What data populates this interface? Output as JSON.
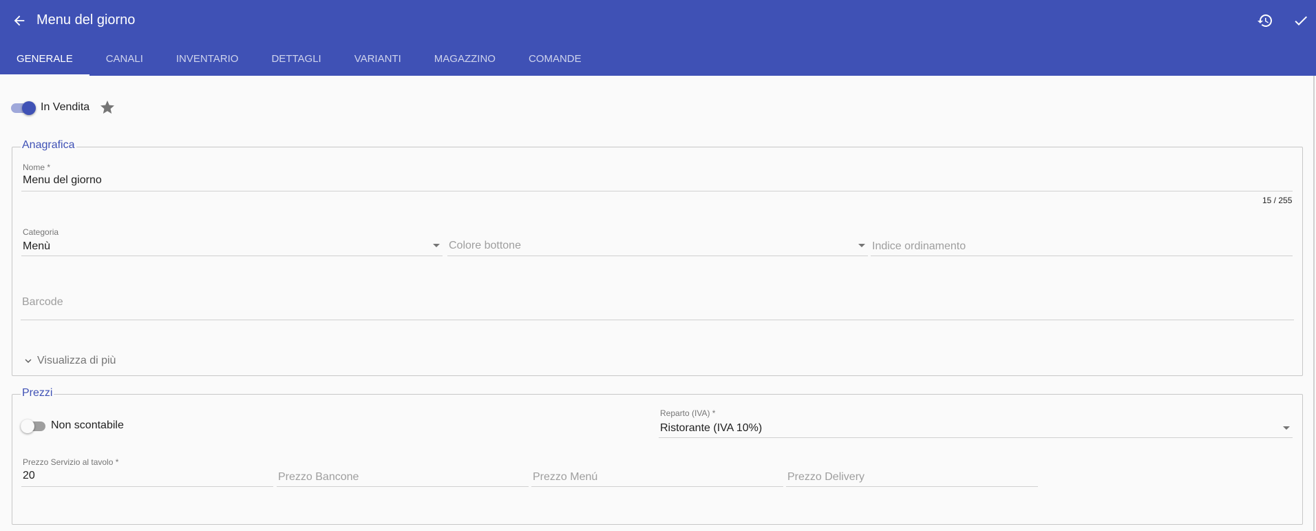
{
  "header": {
    "title": "Menu del giorno",
    "back_icon": "arrow-left-icon",
    "history_icon": "history-icon",
    "confirm_icon": "check-icon",
    "accent": "#3f51b5"
  },
  "tabs": [
    {
      "label": "GENERALE",
      "active": true
    },
    {
      "label": "CANALI"
    },
    {
      "label": "INVENTARIO"
    },
    {
      "label": "DETTAGLI"
    },
    {
      "label": "VARIANTI"
    },
    {
      "label": "MAGAZZINO"
    },
    {
      "label": "COMANDE"
    }
  ],
  "sale": {
    "label": "In Vendita",
    "on": true
  },
  "anagrafica": {
    "legend": "Anagrafica",
    "nome": {
      "label": "Nome *",
      "value": "Menu del giorno",
      "counter": "15 / 255"
    },
    "categoria": {
      "label": "Categoria",
      "value": "Menù"
    },
    "colore": {
      "placeholder": "Colore bottone"
    },
    "indice": {
      "placeholder": "Indice ordinamento"
    },
    "barcode": {
      "placeholder": "Barcode"
    },
    "more_label": "Visualizza di più"
  },
  "prezzi": {
    "legend": "Prezzi",
    "non_scontabile": {
      "label": "Non scontabile",
      "on": false
    },
    "reparto": {
      "label": "Reparto (IVA) *",
      "value": "Ristorante (IVA 10%)"
    },
    "servizio": {
      "label": "Prezzo Servizio al tavolo *",
      "value": "20"
    },
    "bancone": {
      "placeholder": "Prezzo Bancone"
    },
    "menu": {
      "placeholder": "Prezzo Menú"
    },
    "delivery": {
      "placeholder": "Prezzo Delivery"
    }
  }
}
